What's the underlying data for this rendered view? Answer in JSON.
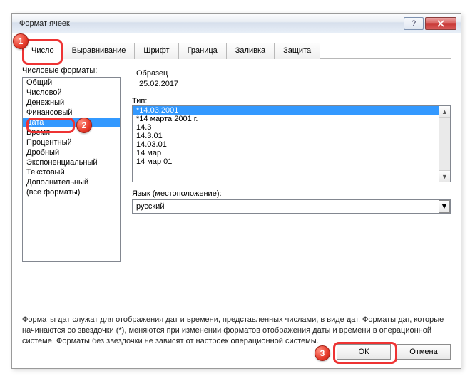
{
  "window": {
    "title": "Формат ячеек"
  },
  "tabs": [
    "Число",
    "Выравнивание",
    "Шрифт",
    "Граница",
    "Заливка",
    "Защита"
  ],
  "active_tab": 0,
  "category_label": "Числовые форматы:",
  "categories": [
    "Общий",
    "Числовой",
    "Денежный",
    "Финансовый",
    "Дата",
    "Время",
    "Процентный",
    "Дробный",
    "Экспоненциальный",
    "Текстовый",
    "Дополнительный",
    "(все форматы)"
  ],
  "selected_category": 4,
  "sample": {
    "label": "Образец",
    "value": "25.02.2017"
  },
  "type_label": "Тип:",
  "types": [
    "*14.03.2001",
    "*14 марта 2001 г.",
    "14.3",
    "14.3.01",
    "14.03.01",
    "14 мар",
    "14 мар 01"
  ],
  "selected_type": 0,
  "locale_label": "Язык (местоположение):",
  "locale_value": "русский",
  "description": "Форматы дат служат для отображения дат и времени, представленных числами, в виде дат. Форматы дат, которые начинаются со звездочки (*), меняются при изменении форматов отображения даты и времени в операционной системе. Форматы без звездочки не зависят от настроек операционной системы.",
  "buttons": {
    "ok": "ОК",
    "cancel": "Отмена"
  },
  "callouts": {
    "1": "1",
    "2": "2",
    "3": "3"
  }
}
